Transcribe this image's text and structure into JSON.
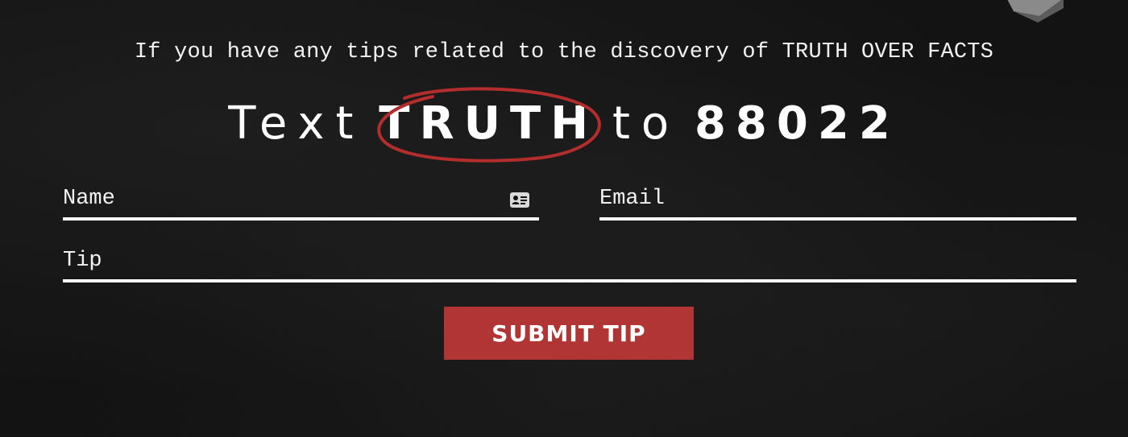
{
  "intro_text": "If you have any tips related to the discovery of TRUTH OVER FACTS",
  "headline": {
    "prefix": "Text",
    "keyword": "TRUTH",
    "connector": "to",
    "number": "88022"
  },
  "form": {
    "name_label": "Name",
    "email_label": "Email",
    "tip_label": "Tip",
    "submit_label": "SUBMIT TIP"
  },
  "icons": {
    "contact_card": "contact-card-icon",
    "circle_mark": "red-circle-scribble"
  },
  "colors": {
    "background": "#111111",
    "text": "#ffffff",
    "accent": "#b13535",
    "scribble": "#b32d2d"
  }
}
